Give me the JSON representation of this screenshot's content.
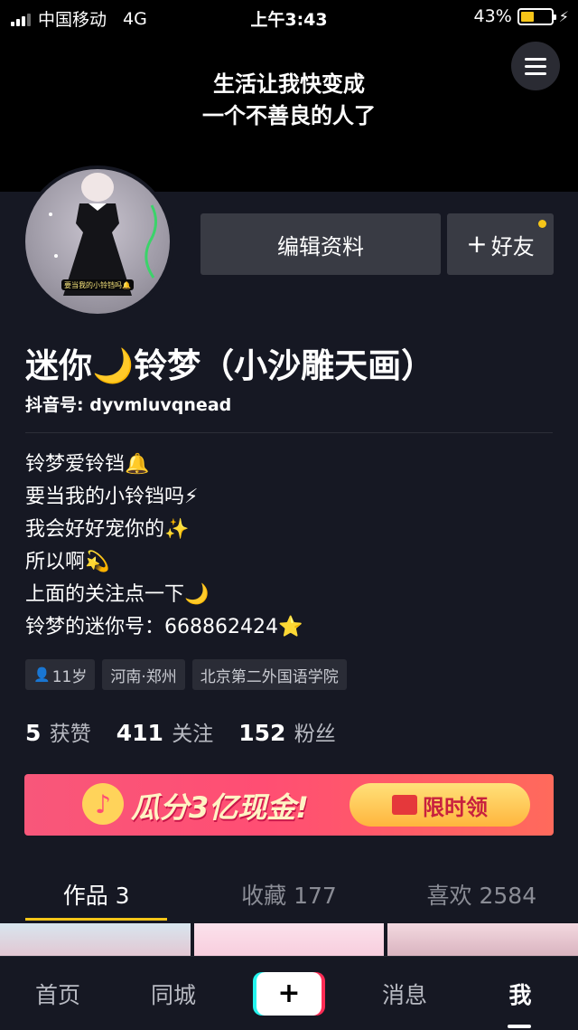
{
  "status_bar": {
    "carrier": "中国移动",
    "network": "4G",
    "time": "上午3:43",
    "battery_percent": "43%",
    "battery_level": 0.43,
    "signal_bars_active": 3
  },
  "banner": {
    "line1": "生活让我快变成",
    "line2": "一个不善良的人了"
  },
  "profile": {
    "avatar_caption": "要当我的小铃铛吗🔔",
    "edit_label": "编辑资料",
    "add_friend_label": "好友",
    "nickname": "迷你🌙铃梦（小沙雕天画）",
    "id_label": "抖音号: dyvmluvqnead",
    "bio": [
      "铃梦爱铃铛🔔",
      "要当我的小铃铛吗⚡",
      "我会好好宠你的✨",
      "所以啊💫",
      "上面的关注点一下🌙",
      "铃梦的迷你号：668862424⭐"
    ],
    "tags": {
      "age": "11岁",
      "location": "河南·郑州",
      "school": "北京第二外国语学院"
    },
    "stats": {
      "likes_value": "5",
      "likes_label": "获赞",
      "following_value": "411",
      "following_label": "关注",
      "followers_value": "152",
      "followers_label": "粉丝"
    }
  },
  "promo": {
    "logo": "♪",
    "text": "瓜分3亿现金!",
    "cta": "限时领"
  },
  "tabs": [
    {
      "label": "作品 3"
    },
    {
      "label": "收藏 177"
    },
    {
      "label": "喜欢 2584"
    }
  ],
  "bottom_nav": {
    "home": "首页",
    "city": "同城",
    "plus": "+",
    "messages": "消息",
    "me": "我"
  },
  "colors": {
    "background": "#161823",
    "accent": "#f5c518",
    "button": "#393b44"
  }
}
